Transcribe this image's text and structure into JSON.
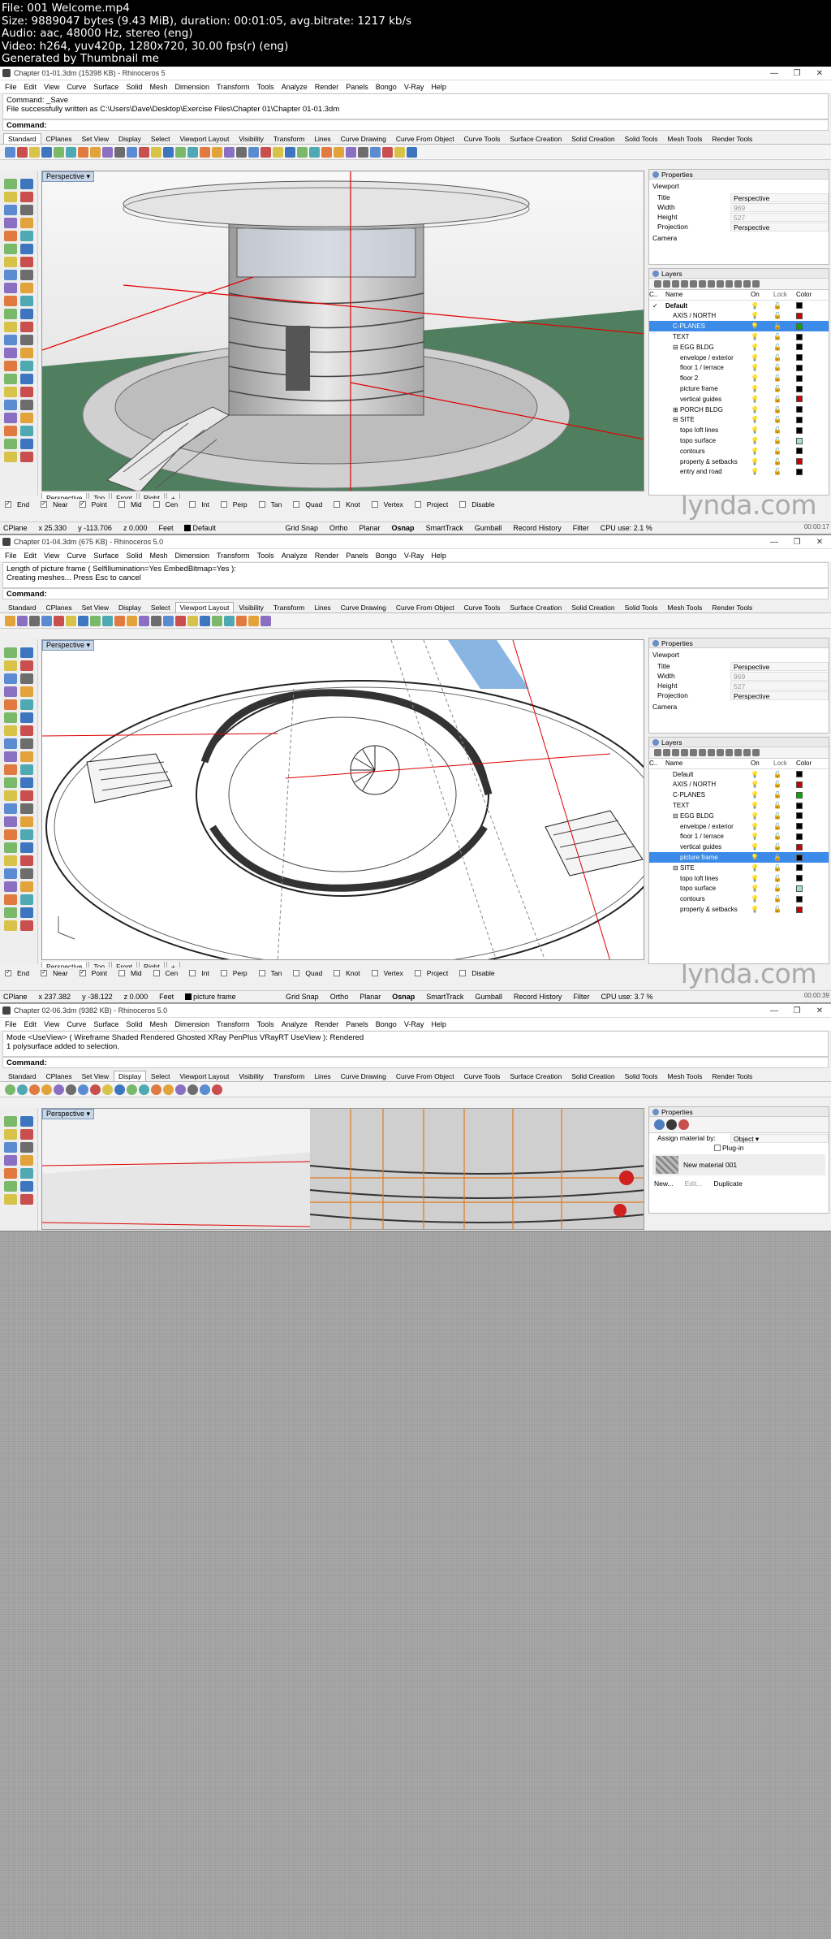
{
  "header": {
    "lines": [
      "File: 001 Welcome.mp4",
      "Size: 9889047 bytes (9.43 MiB), duration: 00:01:05, avg.bitrate: 1217 kb/s",
      "Audio: aac, 48000 Hz, stereo (eng)",
      "Video: h264, yuv420p, 1280x720, 30.00 fps(r) (eng)",
      "Generated by Thumbnail me"
    ]
  },
  "menu": [
    "File",
    "Edit",
    "View",
    "Curve",
    "Surface",
    "Solid",
    "Mesh",
    "Dimension",
    "Transform",
    "Tools",
    "Analyze",
    "Render",
    "Panels",
    "Bongo",
    "V-Ray",
    "Help"
  ],
  "tabs": [
    "Standard",
    "CPlanes",
    "Set View",
    "Display",
    "Select",
    "Viewport Layout",
    "Visibility",
    "Transform",
    "Lines",
    "Curve Drawing",
    "Curve From Object",
    "Curve Tools",
    "Surface Creation",
    "Solid Creation",
    "Solid Tools",
    "Mesh Tools",
    "Render Tools"
  ],
  "osnaps": [
    "End",
    "Near",
    "Point",
    "Mid",
    "Cen",
    "Int",
    "Perp",
    "Tan",
    "Quad",
    "Knot",
    "Vertex",
    "Project",
    "Disable"
  ],
  "viewport_tabs": [
    "Perspective",
    "Top",
    "Front",
    "Right"
  ],
  "status_items": [
    "Grid Snap",
    "Ortho",
    "Planar",
    "Osnap",
    "SmartTrack",
    "Gumball",
    "Record History",
    "Filter"
  ],
  "watermark": "lynda.com",
  "frames": [
    {
      "title": "Chapter 01-01.3dm (15398 KB) - Rhinoceros 5",
      "cmd_history": [
        "Command: _Save",
        "File successfully written as C:\\Users\\Dave\\Desktop\\Exercise Files\\Chapter 01\\Chapter 01-01.3dm"
      ],
      "cmd_label": "Command:",
      "active_tab": "Standard",
      "viewport_label": "Perspective",
      "status": {
        "cplane": "CPlane",
        "x": "x 25.330",
        "y": "y -113.706",
        "z": "z 0.000",
        "unit": "Feet",
        "layer": "Default",
        "cpu": "CPU use: 2.1 %"
      },
      "timestamp": "00:00:17",
      "properties": {
        "title": "Properties",
        "section": "Viewport",
        "rows": [
          [
            "Title",
            "Perspective"
          ],
          [
            "Width",
            "969"
          ],
          [
            "Height",
            "527"
          ],
          [
            "Projection",
            "Perspective"
          ]
        ],
        "extra": "Camera"
      },
      "layers": {
        "title": "Layers",
        "cols": [
          "C..",
          "Name",
          "On",
          "Lock",
          "Color"
        ],
        "rows": [
          {
            "name": "Default",
            "indent": 0,
            "color": "#000000",
            "bold": true,
            "sel": false
          },
          {
            "name": "AXIS / NORTH",
            "indent": 1,
            "color": "#cc0000",
            "sel": false
          },
          {
            "name": "C-PLANES",
            "indent": 1,
            "color": "#00aa00",
            "sel": true
          },
          {
            "name": "TEXT",
            "indent": 1,
            "color": "#000000",
            "sel": false
          },
          {
            "name": "EGG BLDG",
            "indent": 1,
            "color": "#000000",
            "sel": false,
            "expand": "⊟"
          },
          {
            "name": "envelope / exterior",
            "indent": 2,
            "color": "#000000",
            "sel": false
          },
          {
            "name": "floor 1 / terrace",
            "indent": 2,
            "color": "#000000",
            "sel": false
          },
          {
            "name": "floor 2",
            "indent": 2,
            "color": "#000000",
            "sel": false
          },
          {
            "name": "picture frame",
            "indent": 2,
            "color": "#000000",
            "sel": false
          },
          {
            "name": "vertical guides",
            "indent": 2,
            "color": "#cc0000",
            "sel": false
          },
          {
            "name": "PORCH BLDG",
            "indent": 1,
            "color": "#000000",
            "sel": false,
            "expand": "⊞"
          },
          {
            "name": "SITE",
            "indent": 1,
            "color": "#000000",
            "sel": false,
            "expand": "⊟"
          },
          {
            "name": "topo loft lines",
            "indent": 2,
            "color": "#000000",
            "sel": false
          },
          {
            "name": "topo surface",
            "indent": 2,
            "color": "#9ee6c0",
            "sel": false
          },
          {
            "name": "contours",
            "indent": 2,
            "color": "#000000",
            "sel": false
          },
          {
            "name": "property & setbacks",
            "indent": 2,
            "color": "#cc0000",
            "sel": false
          },
          {
            "name": "entry and road",
            "indent": 2,
            "color": "#000000",
            "sel": false
          }
        ]
      }
    },
    {
      "title": "Chapter 01-04.3dm (675 KB) - Rhinoceros 5.0",
      "cmd_history": [
        "Length of picture frame ( Selfillumination=Yes  EmbedBitmap=Yes ):",
        "Creating meshes... Press Esc to cancel"
      ],
      "cmd_label": "Command:",
      "active_tab": "Viewport Layout",
      "viewport_label": "Perspective",
      "status": {
        "cplane": "CPlane",
        "x": "x 237.382",
        "y": "y -38.122",
        "z": "z 0.000",
        "unit": "Feet",
        "layer": "picture frame",
        "cpu": "CPU use: 3.7 %"
      },
      "timestamp": "00:00:39",
      "properties": {
        "title": "Properties",
        "section": "Viewport",
        "rows": [
          [
            "Title",
            "Perspective"
          ],
          [
            "Width",
            "969"
          ],
          [
            "Height",
            "527"
          ],
          [
            "Projection",
            "Perspective"
          ]
        ],
        "extra": "Camera"
      },
      "layers": {
        "title": "Layers",
        "cols": [
          "C..",
          "Name",
          "On",
          "Lock",
          "Color"
        ],
        "rows": [
          {
            "name": "Default",
            "indent": 1,
            "color": "#000000",
            "sel": false
          },
          {
            "name": "AXIS / NORTH",
            "indent": 1,
            "color": "#cc0000",
            "sel": false
          },
          {
            "name": "C-PLANES",
            "indent": 1,
            "color": "#00aa00",
            "sel": false
          },
          {
            "name": "TEXT",
            "indent": 1,
            "color": "#000000",
            "sel": false
          },
          {
            "name": "EGG BLDG",
            "indent": 1,
            "color": "#000000",
            "sel": false,
            "expand": "⊟"
          },
          {
            "name": "envelope / exterior",
            "indent": 2,
            "color": "#000000",
            "sel": false
          },
          {
            "name": "floor 1 / terrace",
            "indent": 2,
            "color": "#000000",
            "sel": false
          },
          {
            "name": "vertical guides",
            "indent": 2,
            "color": "#cc0000",
            "sel": false
          },
          {
            "name": "picture frame",
            "indent": 2,
            "color": "#000000",
            "sel": true
          },
          {
            "name": "SITE",
            "indent": 1,
            "color": "#000000",
            "sel": false,
            "expand": "⊟"
          },
          {
            "name": "topo loft lines",
            "indent": 2,
            "color": "#000000",
            "sel": false
          },
          {
            "name": "topo surface",
            "indent": 2,
            "color": "#9ee6c0",
            "sel": false
          },
          {
            "name": "contours",
            "indent": 2,
            "color": "#000000",
            "sel": false
          },
          {
            "name": "property & setbacks",
            "indent": 2,
            "color": "#cc0000",
            "sel": false
          }
        ]
      }
    },
    {
      "title": "Chapter 02-06.3dm (9382 KB) - Rhinoceros 5.0",
      "cmd_history": [
        "Mode <UseView> ( Wireframe  Shaded  Rendered  Ghosted  XRay  PenPlus  VRayRT  UseView ): Rendered",
        "1 polysurface added to selection."
      ],
      "cmd_label": "Command:",
      "active_tab": "Display",
      "viewport_label": "Perspective",
      "properties3": {
        "title": "Properties",
        "assign_label": "Assign material by:",
        "assign_value": "Object",
        "plugin": "Plug-in",
        "material": "New material 001",
        "new_btn": "New...",
        "edit_btn": "Edit...",
        "dup_btn": "Duplicate"
      }
    }
  ]
}
